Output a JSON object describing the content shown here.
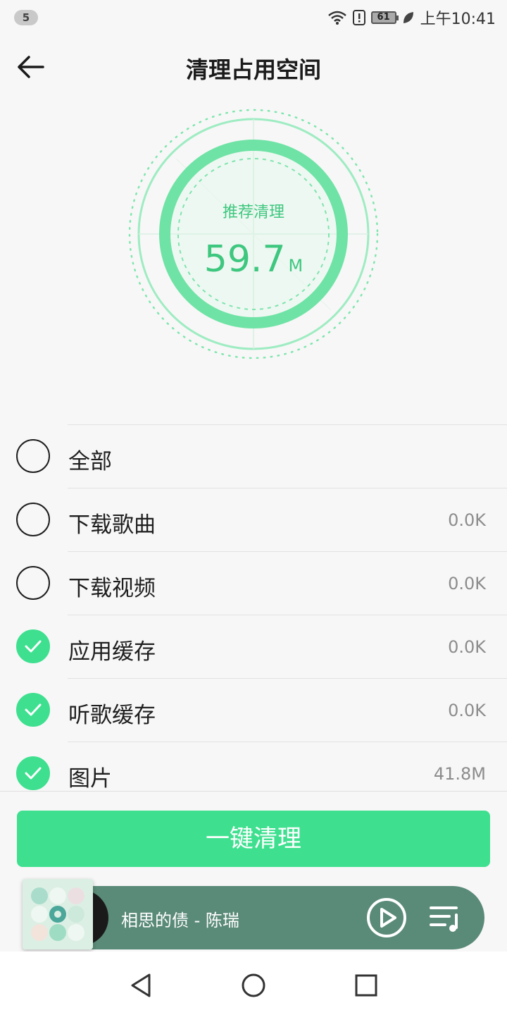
{
  "status_bar": {
    "notification_count": "5",
    "battery_level": "61",
    "time": "上午10:41",
    "icons": [
      "wifi-icon",
      "alert-icon",
      "battery-icon",
      "leaf-icon"
    ]
  },
  "header": {
    "title": "清理占用空间",
    "back_icon": "arrow-left-icon"
  },
  "gauge": {
    "label": "推荐清理",
    "value": "59.7",
    "unit": "M"
  },
  "items": [
    {
      "label": "全部",
      "size": "",
      "checked": false
    },
    {
      "label": "下载歌曲",
      "size": "0.0K",
      "checked": false
    },
    {
      "label": "下载视频",
      "size": "0.0K",
      "checked": false
    },
    {
      "label": "应用缓存",
      "size": "0.0K",
      "checked": true
    },
    {
      "label": "听歌缓存",
      "size": "0.0K",
      "checked": true
    },
    {
      "label": "图片",
      "size": "41.8M",
      "checked": true
    }
  ],
  "clean_button": {
    "label": "一键清理"
  },
  "player": {
    "song": "相思的债 - 陈瑞",
    "play_icon": "play-icon",
    "playlist_icon": "playlist-icon"
  },
  "colors": {
    "accent": "#3ee08f",
    "accent_text": "#3ec77f",
    "player_bg": "#5a8a78"
  }
}
